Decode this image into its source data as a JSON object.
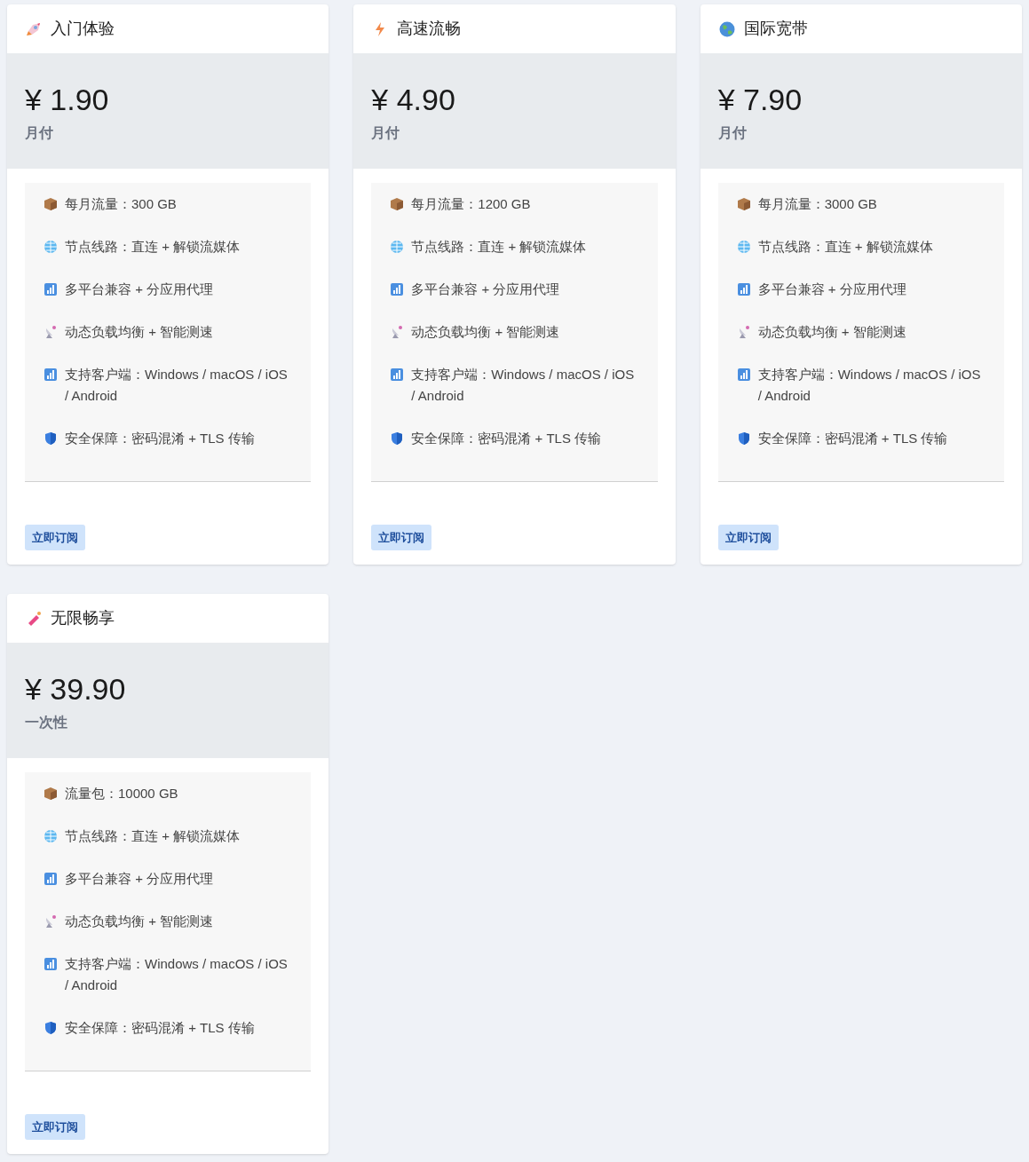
{
  "plans": [
    {
      "kind": "rocket",
      "name": "入门体验",
      "price": "¥ 1.90",
      "period": "月付",
      "features": [
        {
          "kind": "box",
          "text": "每月流量：300 GB"
        },
        {
          "kind": "globe",
          "text": "节点线路：直连 + 解锁流媒体"
        },
        {
          "kind": "chart",
          "text": "多平台兼容 + 分应用代理"
        },
        {
          "kind": "satellite",
          "text": "动态负载均衡 + 智能测速"
        },
        {
          "kind": "chart",
          "text": "支持客户端：Windows / macOS / iOS / Android"
        },
        {
          "kind": "shield",
          "text": "安全保障：密码混淆 + TLS 传输"
        }
      ],
      "button": "立即订阅"
    },
    {
      "kind": "bolt",
      "name": "高速流畅",
      "price": "¥ 4.90",
      "period": "月付",
      "features": [
        {
          "kind": "box",
          "text": "每月流量：1200 GB"
        },
        {
          "kind": "globe",
          "text": "节点线路：直连 + 解锁流媒体"
        },
        {
          "kind": "chart",
          "text": "多平台兼容 + 分应用代理"
        },
        {
          "kind": "satellite",
          "text": "动态负载均衡 + 智能测速"
        },
        {
          "kind": "chart",
          "text": "支持客户端：Windows / macOS / iOS / Android"
        },
        {
          "kind": "shield",
          "text": "安全保障：密码混淆 + TLS 传输"
        }
      ],
      "button": "立即订阅"
    },
    {
      "kind": "earth",
      "name": "国际宽带",
      "price": "¥ 7.90",
      "period": "月付",
      "features": [
        {
          "kind": "box",
          "text": "每月流量：3000 GB"
        },
        {
          "kind": "globe",
          "text": "节点线路：直连 + 解锁流媒体"
        },
        {
          "kind": "chart",
          "text": "多平台兼容 + 分应用代理"
        },
        {
          "kind": "satellite",
          "text": "动态负载均衡 + 智能测速"
        },
        {
          "kind": "chart",
          "text": "支持客户端：Windows / macOS / iOS / Android"
        },
        {
          "kind": "shield",
          "text": "安全保障：密码混淆 + TLS 传输"
        }
      ],
      "button": "立即订阅"
    },
    {
      "kind": "firecracker",
      "name": "无限畅享",
      "price": "¥ 39.90",
      "period": "一次性",
      "features": [
        {
          "kind": "box",
          "text": "流量包：10000 GB"
        },
        {
          "kind": "globe",
          "text": "节点线路：直连 + 解锁流媒体"
        },
        {
          "kind": "chart",
          "text": "多平台兼容 + 分应用代理"
        },
        {
          "kind": "satellite",
          "text": "动态负载均衡 + 智能测速"
        },
        {
          "kind": "chart",
          "text": "支持客户端：Windows / macOS / iOS / Android"
        },
        {
          "kind": "shield",
          "text": "安全保障：密码混淆 + TLS 传输"
        }
      ],
      "button": "立即订阅"
    }
  ]
}
